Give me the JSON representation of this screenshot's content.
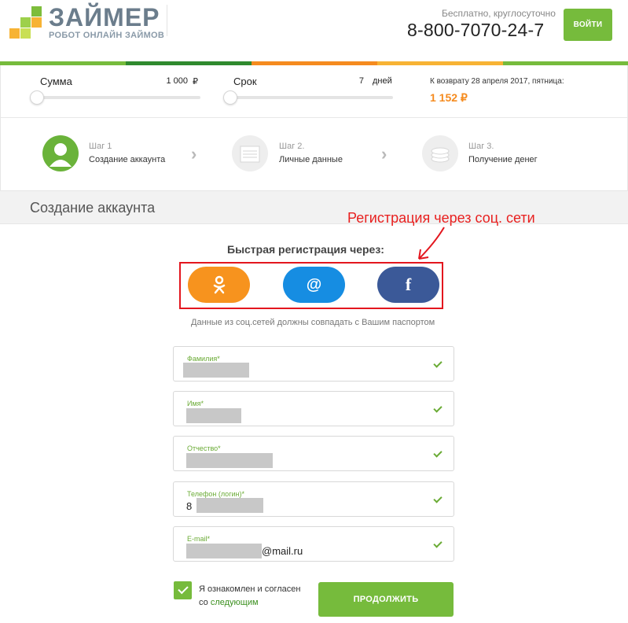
{
  "header": {
    "logo_title": "ЗАЙМЕР",
    "logo_subtitle": "РОБОТ ОНЛАЙН ЗАЙМОВ",
    "tagline": "Бесплатно, круглосуточно",
    "phone": "8-800-7070-24-7",
    "login_label": "ВОЙТИ"
  },
  "calculator": {
    "sum_label": "Сумма",
    "sum_value": "1 000",
    "sum_unit": "₽",
    "term_label": "Срок",
    "term_value": "7",
    "term_unit": "дней",
    "return_label": "К возврату 28 апреля 2017, пятница:",
    "return_amount": "1 152 ₽"
  },
  "steps": [
    {
      "num": "Шаг 1",
      "name": "Создание аккаунта",
      "icon": "user-icon"
    },
    {
      "num": "Шаг 2.",
      "name": "Личные данные",
      "icon": "document-icon"
    },
    {
      "num": "Шаг 3.",
      "name": "Получение денег",
      "icon": "money-icon"
    }
  ],
  "section": {
    "title": "Создание аккаунта"
  },
  "annotation": "Регистрация через соц. сети",
  "social": {
    "title": "Быстрая регистрация через:",
    "buttons": [
      {
        "name": "odnoklassniki",
        "glyph": "ok",
        "color": "#f7931e"
      },
      {
        "name": "mailru",
        "glyph": "@",
        "color": "#168de2"
      },
      {
        "name": "facebook",
        "glyph": "f",
        "color": "#3b5998"
      }
    ],
    "note": "Данные из соц.сетей должны совпадать с Вашим паспортом"
  },
  "form": {
    "fields": [
      {
        "label": "Фамилия*",
        "value": ""
      },
      {
        "label": "Имя*",
        "value": ""
      },
      {
        "label": "Отчество*",
        "value": ""
      },
      {
        "label": "Телефон (логин)*",
        "value_prefix": "8",
        "value_suffix": "8"
      },
      {
        "label": "E-mail*",
        "value_suffix": "@mail.ru"
      }
    ],
    "agree_text": "Я ознакомлен и согласен",
    "agree_prefix": "со",
    "agree_link": "следующим",
    "continue_label": "ПРОДОЛЖИТЬ"
  },
  "colors": {
    "accent_green": "#76bb3c",
    "orange": "#f58b1f",
    "annotation_red": "#e3161e"
  }
}
